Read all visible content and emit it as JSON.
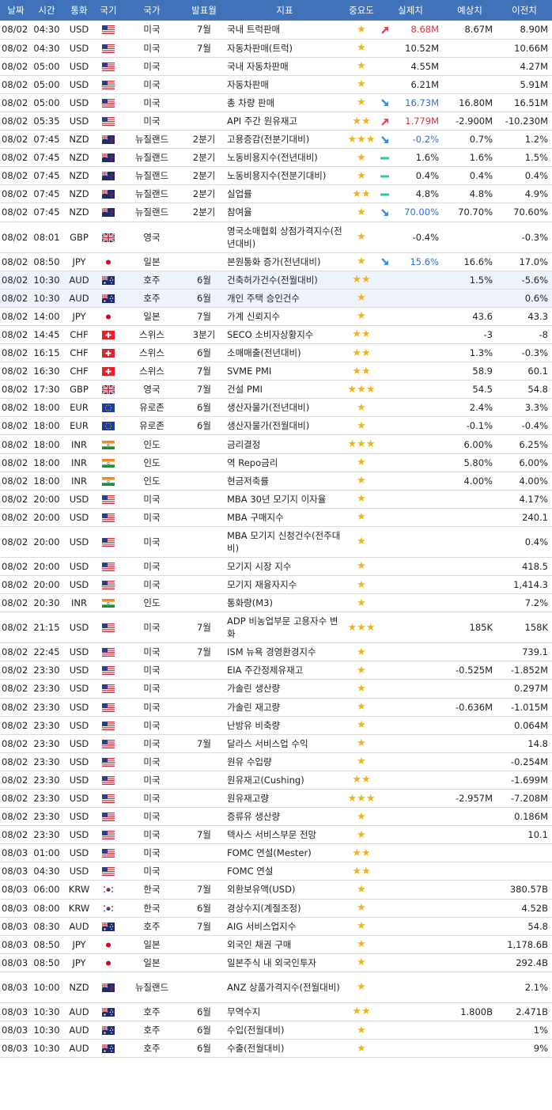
{
  "headers": [
    "날짜",
    "시간",
    "통화",
    "국기",
    "국가",
    "발표월",
    "지표",
    "중요도",
    "실제치",
    "예상치",
    "이전치"
  ],
  "colors": {
    "header_bg": "#3f72b8",
    "star": "#f2b31a",
    "up": "#e0303f",
    "down": "#2f6fd6",
    "neutral": "#2dc99a",
    "highlight": "#eef2fb"
  },
  "rows": [
    {
      "date": "08/02",
      "time": "04:30",
      "cur": "USD",
      "flag": "us",
      "country": "미국",
      "period": "7월",
      "indicator": "국내 트럭판매",
      "stars": "★",
      "dir": "up",
      "actual": "8.68M",
      "forecast": "8.67M",
      "previous": "8.90M"
    },
    {
      "date": "08/02",
      "time": "04:30",
      "cur": "USD",
      "flag": "us",
      "country": "미국",
      "period": "7월",
      "indicator": "자동차판매(트럭)",
      "stars": "★",
      "dir": "",
      "actual": "10.52M",
      "forecast": "",
      "previous": "10.66M"
    },
    {
      "date": "08/02",
      "time": "05:00",
      "cur": "USD",
      "flag": "us",
      "country": "미국",
      "period": "",
      "indicator": "국내 자동차판매",
      "stars": "★",
      "dir": "",
      "actual": "4.55M",
      "forecast": "",
      "previous": "4.27M"
    },
    {
      "date": "08/02",
      "time": "05:00",
      "cur": "USD",
      "flag": "us",
      "country": "미국",
      "period": "",
      "indicator": "자동차판매",
      "stars": "★",
      "dir": "",
      "actual": "6.21M",
      "forecast": "",
      "previous": "5.91M"
    },
    {
      "date": "08/02",
      "time": "05:00",
      "cur": "USD",
      "flag": "us",
      "country": "미국",
      "period": "",
      "indicator": "총 차량 판매",
      "stars": "★",
      "dir": "down",
      "actual": "16.73M",
      "forecast": "16.80M",
      "previous": "16.51M"
    },
    {
      "date": "08/02",
      "time": "05:35",
      "cur": "USD",
      "flag": "us",
      "country": "미국",
      "period": "",
      "indicator": "API 주간 원유재고",
      "stars": "★★",
      "dir": "up",
      "actual": "1.779M",
      "forecast": "-2.900M",
      "previous": "-10.230M"
    },
    {
      "date": "08/02",
      "time": "07:45",
      "cur": "NZD",
      "flag": "nz",
      "country": "뉴질랜드",
      "period": "2분기",
      "indicator": "고용증감(전분기대비)",
      "stars": "★★★",
      "dir": "down",
      "actual": "-0.2%",
      "forecast": "0.7%",
      "previous": "1.2%"
    },
    {
      "date": "08/02",
      "time": "07:45",
      "cur": "NZD",
      "flag": "nz",
      "country": "뉴질랜드",
      "period": "2분기",
      "indicator": "노동비용지수(전년대비)",
      "stars": "★",
      "dir": "same",
      "actual": "1.6%",
      "forecast": "1.6%",
      "previous": "1.5%"
    },
    {
      "date": "08/02",
      "time": "07:45",
      "cur": "NZD",
      "flag": "nz",
      "country": "뉴질랜드",
      "period": "2분기",
      "indicator": "노동비용지수(전분기대비)",
      "stars": "★",
      "dir": "same",
      "actual": "0.4%",
      "forecast": "0.4%",
      "previous": "0.4%"
    },
    {
      "date": "08/02",
      "time": "07:45",
      "cur": "NZD",
      "flag": "nz",
      "country": "뉴질랜드",
      "period": "2분기",
      "indicator": "실업률",
      "stars": "★★",
      "dir": "same",
      "actual": "4.8%",
      "forecast": "4.8%",
      "previous": "4.9%"
    },
    {
      "date": "08/02",
      "time": "07:45",
      "cur": "NZD",
      "flag": "nz",
      "country": "뉴질랜드",
      "period": "2분기",
      "indicator": "참여율",
      "stars": "★",
      "dir": "down",
      "actual": "70.00%",
      "forecast": "70.70%",
      "previous": "70.60%"
    },
    {
      "date": "08/02",
      "time": "08:01",
      "cur": "GBP",
      "flag": "gb",
      "country": "영국",
      "period": "",
      "indicator": "영국소매협회 상점가격지수(전년대비)",
      "stars": "★",
      "dir": "",
      "actual": "-0.4%",
      "forecast": "",
      "previous": "-0.3%",
      "tall": true
    },
    {
      "date": "08/02",
      "time": "08:50",
      "cur": "JPY",
      "flag": "jp",
      "country": "일본",
      "period": "",
      "indicator": "본원통화 증가(전년대비)",
      "stars": "★",
      "dir": "down",
      "actual": "15.6%",
      "forecast": "16.6%",
      "previous": "17.0%"
    },
    {
      "date": "08/02",
      "time": "10:30",
      "cur": "AUD",
      "flag": "au",
      "country": "호주",
      "period": "6월",
      "indicator": "건축허가건수(전월대비)",
      "stars": "★★",
      "dir": "",
      "actual": "",
      "forecast": "1.5%",
      "previous": "-5.6%",
      "hl": true
    },
    {
      "date": "08/02",
      "time": "10:30",
      "cur": "AUD",
      "flag": "au",
      "country": "호주",
      "period": "6월",
      "indicator": "개인 주택 승인건수",
      "stars": "★",
      "dir": "",
      "actual": "",
      "forecast": "",
      "previous": "0.6%",
      "hl": true
    },
    {
      "date": "08/02",
      "time": "14:00",
      "cur": "JPY",
      "flag": "jp",
      "country": "일본",
      "period": "7월",
      "indicator": "가계 신뢰지수",
      "stars": "★",
      "dir": "",
      "actual": "",
      "forecast": "43.6",
      "previous": "43.3"
    },
    {
      "date": "08/02",
      "time": "14:45",
      "cur": "CHF",
      "flag": "ch",
      "country": "스위스",
      "period": "3분기",
      "indicator": "SECO 소비자상황지수",
      "stars": "★★",
      "dir": "",
      "actual": "",
      "forecast": "-3",
      "previous": "-8"
    },
    {
      "date": "08/02",
      "time": "16:15",
      "cur": "CHF",
      "flag": "ch",
      "country": "스위스",
      "period": "6월",
      "indicator": "소매매출(전년대비)",
      "stars": "★★",
      "dir": "",
      "actual": "",
      "forecast": "1.3%",
      "previous": "-0.3%"
    },
    {
      "date": "08/02",
      "time": "16:30",
      "cur": "CHF",
      "flag": "ch",
      "country": "스위스",
      "period": "7월",
      "indicator": "SVME PMI",
      "stars": "★★",
      "dir": "",
      "actual": "",
      "forecast": "58.9",
      "previous": "60.1"
    },
    {
      "date": "08/02",
      "time": "17:30",
      "cur": "GBP",
      "flag": "gb",
      "country": "영국",
      "period": "7월",
      "indicator": "건설 PMI",
      "stars": "★★★",
      "dir": "",
      "actual": "",
      "forecast": "54.5",
      "previous": "54.8"
    },
    {
      "date": "08/02",
      "time": "18:00",
      "cur": "EUR",
      "flag": "eu",
      "country": "유로존",
      "period": "6월",
      "indicator": "생산자물가(전년대비)",
      "stars": "★",
      "dir": "",
      "actual": "",
      "forecast": "2.4%",
      "previous": "3.3%"
    },
    {
      "date": "08/02",
      "time": "18:00",
      "cur": "EUR",
      "flag": "eu",
      "country": "유로존",
      "period": "6월",
      "indicator": "생산자물가(전월대비)",
      "stars": "★",
      "dir": "",
      "actual": "",
      "forecast": "-0.1%",
      "previous": "-0.4%"
    },
    {
      "date": "08/02",
      "time": "18:00",
      "cur": "INR",
      "flag": "in",
      "country": "인도",
      "period": "",
      "indicator": "금리결정",
      "stars": "★★★",
      "dir": "",
      "actual": "",
      "forecast": "6.00%",
      "previous": "6.25%"
    },
    {
      "date": "08/02",
      "time": "18:00",
      "cur": "INR",
      "flag": "in",
      "country": "인도",
      "period": "",
      "indicator": "역 Repo금리",
      "stars": "★",
      "dir": "",
      "actual": "",
      "forecast": "5.80%",
      "previous": "6.00%"
    },
    {
      "date": "08/02",
      "time": "18:00",
      "cur": "INR",
      "flag": "in",
      "country": "인도",
      "period": "",
      "indicator": "현금저축률",
      "stars": "★",
      "dir": "",
      "actual": "",
      "forecast": "4.00%",
      "previous": "4.00%"
    },
    {
      "date": "08/02",
      "time": "20:00",
      "cur": "USD",
      "flag": "us",
      "country": "미국",
      "period": "",
      "indicator": "MBA 30년 모기지 이자율",
      "stars": "★",
      "dir": "",
      "actual": "",
      "forecast": "",
      "previous": "4.17%"
    },
    {
      "date": "08/02",
      "time": "20:00",
      "cur": "USD",
      "flag": "us",
      "country": "미국",
      "period": "",
      "indicator": "MBA 구매지수",
      "stars": "★",
      "dir": "",
      "actual": "",
      "forecast": "",
      "previous": "240.1"
    },
    {
      "date": "08/02",
      "time": "20:00",
      "cur": "USD",
      "flag": "us",
      "country": "미국",
      "period": "",
      "indicator": "MBA 모기지 신청건수(전주대비)",
      "stars": "★",
      "dir": "",
      "actual": "",
      "forecast": "",
      "previous": "0.4%",
      "tall": true
    },
    {
      "date": "08/02",
      "time": "20:00",
      "cur": "USD",
      "flag": "us",
      "country": "미국",
      "period": "",
      "indicator": "모기지 시장 지수",
      "stars": "★",
      "dir": "",
      "actual": "",
      "forecast": "",
      "previous": "418.5"
    },
    {
      "date": "08/02",
      "time": "20:00",
      "cur": "USD",
      "flag": "us",
      "country": "미국",
      "period": "",
      "indicator": "모기지 재융자지수",
      "stars": "★",
      "dir": "",
      "actual": "",
      "forecast": "",
      "previous": "1,414.3"
    },
    {
      "date": "08/02",
      "time": "20:30",
      "cur": "INR",
      "flag": "in",
      "country": "인도",
      "period": "",
      "indicator": "통화량(M3)",
      "stars": "★",
      "dir": "",
      "actual": "",
      "forecast": "",
      "previous": "7.2%"
    },
    {
      "date": "08/02",
      "time": "21:15",
      "cur": "USD",
      "flag": "us",
      "country": "미국",
      "period": "7월",
      "indicator": "ADP 비농업부문 고용자수 변화",
      "stars": "★★★",
      "dir": "",
      "actual": "",
      "forecast": "185K",
      "previous": "158K",
      "tall": true
    },
    {
      "date": "08/02",
      "time": "22:45",
      "cur": "USD",
      "flag": "us",
      "country": "미국",
      "period": "7월",
      "indicator": "ISM 뉴욕 경영환경지수",
      "stars": "★",
      "dir": "",
      "actual": "",
      "forecast": "",
      "previous": "739.1"
    },
    {
      "date": "08/02",
      "time": "23:30",
      "cur": "USD",
      "flag": "us",
      "country": "미국",
      "period": "",
      "indicator": "EIA 주간정제유재고",
      "stars": "★",
      "dir": "",
      "actual": "",
      "forecast": "-0.525M",
      "previous": "-1.852M"
    },
    {
      "date": "08/02",
      "time": "23:30",
      "cur": "USD",
      "flag": "us",
      "country": "미국",
      "period": "",
      "indicator": "가솔린 생산량",
      "stars": "★",
      "dir": "",
      "actual": "",
      "forecast": "",
      "previous": "0.297M"
    },
    {
      "date": "08/02",
      "time": "23:30",
      "cur": "USD",
      "flag": "us",
      "country": "미국",
      "period": "",
      "indicator": "가솔린 재고량",
      "stars": "★",
      "dir": "",
      "actual": "",
      "forecast": "-0.636M",
      "previous": "-1.015M"
    },
    {
      "date": "08/02",
      "time": "23:30",
      "cur": "USD",
      "flag": "us",
      "country": "미국",
      "period": "",
      "indicator": "난방유 비축량",
      "stars": "★",
      "dir": "",
      "actual": "",
      "forecast": "",
      "previous": "0.064M"
    },
    {
      "date": "08/02",
      "time": "23:30",
      "cur": "USD",
      "flag": "us",
      "country": "미국",
      "period": "7월",
      "indicator": "달라스 서비스업 수익",
      "stars": "★",
      "dir": "",
      "actual": "",
      "forecast": "",
      "previous": "14.8"
    },
    {
      "date": "08/02",
      "time": "23:30",
      "cur": "USD",
      "flag": "us",
      "country": "미국",
      "period": "",
      "indicator": "원유 수입량",
      "stars": "★",
      "dir": "",
      "actual": "",
      "forecast": "",
      "previous": "-0.254M"
    },
    {
      "date": "08/02",
      "time": "23:30",
      "cur": "USD",
      "flag": "us",
      "country": "미국",
      "period": "",
      "indicator": "원유재고(Cushing)",
      "stars": "★★",
      "dir": "",
      "actual": "",
      "forecast": "",
      "previous": "-1.699M"
    },
    {
      "date": "08/02",
      "time": "23:30",
      "cur": "USD",
      "flag": "us",
      "country": "미국",
      "period": "",
      "indicator": "원유재고량",
      "stars": "★★★",
      "dir": "",
      "actual": "",
      "forecast": "-2.957M",
      "previous": "-7.208M"
    },
    {
      "date": "08/02",
      "time": "23:30",
      "cur": "USD",
      "flag": "us",
      "country": "미국",
      "period": "",
      "indicator": "증류유 생산량",
      "stars": "★",
      "dir": "",
      "actual": "",
      "forecast": "",
      "previous": "0.186M"
    },
    {
      "date": "08/02",
      "time": "23:30",
      "cur": "USD",
      "flag": "us",
      "country": "미국",
      "period": "7월",
      "indicator": "텍사스 서비스부문 전망",
      "stars": "★",
      "dir": "",
      "actual": "",
      "forecast": "",
      "previous": "10.1"
    },
    {
      "date": "08/03",
      "time": "01:00",
      "cur": "USD",
      "flag": "us",
      "country": "미국",
      "period": "",
      "indicator": "FOMC 연설(Mester)",
      "stars": "★★",
      "dir": "",
      "actual": "",
      "forecast": "",
      "previous": ""
    },
    {
      "date": "08/03",
      "time": "04:30",
      "cur": "USD",
      "flag": "us",
      "country": "미국",
      "period": "",
      "indicator": "FOMC 연설",
      "stars": "★★",
      "dir": "",
      "actual": "",
      "forecast": "",
      "previous": ""
    },
    {
      "date": "08/03",
      "time": "06:00",
      "cur": "KRW",
      "flag": "kr",
      "country": "한국",
      "period": "7월",
      "indicator": "외환보유액(USD)",
      "stars": "★",
      "dir": "",
      "actual": "",
      "forecast": "",
      "previous": "380.57B"
    },
    {
      "date": "08/03",
      "time": "08:00",
      "cur": "KRW",
      "flag": "kr",
      "country": "한국",
      "period": "6월",
      "indicator": "경상수지(계절조정)",
      "stars": "★",
      "dir": "",
      "actual": "",
      "forecast": "",
      "previous": "4.52B"
    },
    {
      "date": "08/03",
      "time": "08:30",
      "cur": "AUD",
      "flag": "au",
      "country": "호주",
      "period": "7월",
      "indicator": "AIG 서비스업지수",
      "stars": "★",
      "dir": "",
      "actual": "",
      "forecast": "",
      "previous": "54.8"
    },
    {
      "date": "08/03",
      "time": "08:50",
      "cur": "JPY",
      "flag": "jp",
      "country": "일본",
      "period": "",
      "indicator": "외국인 채권 구매",
      "stars": "★",
      "dir": "",
      "actual": "",
      "forecast": "",
      "previous": "1,178.6B"
    },
    {
      "date": "08/03",
      "time": "08:50",
      "cur": "JPY",
      "flag": "jp",
      "country": "일본",
      "period": "",
      "indicator": "일본주식 내 외국인투자",
      "stars": "★",
      "dir": "",
      "actual": "",
      "forecast": "",
      "previous": "292.4B"
    },
    {
      "date": "08/03",
      "time": "10:00",
      "cur": "NZD",
      "flag": "nz",
      "country": "뉴질랜드",
      "period": "",
      "indicator": "ANZ 상품가격지수(전월대비)",
      "stars": "★",
      "dir": "",
      "actual": "",
      "forecast": "",
      "previous": "2.1%",
      "tall": true
    },
    {
      "date": "08/03",
      "time": "10:30",
      "cur": "AUD",
      "flag": "au",
      "country": "호주",
      "period": "6월",
      "indicator": "무역수지",
      "stars": "★★",
      "dir": "",
      "actual": "",
      "forecast": "1.800B",
      "previous": "2.471B"
    },
    {
      "date": "08/03",
      "time": "10:30",
      "cur": "AUD",
      "flag": "au",
      "country": "호주",
      "period": "6월",
      "indicator": "수입(전월대비)",
      "stars": "★",
      "dir": "",
      "actual": "",
      "forecast": "",
      "previous": "1%"
    },
    {
      "date": "08/03",
      "time": "10:30",
      "cur": "AUD",
      "flag": "au",
      "country": "호주",
      "period": "6월",
      "indicator": "수출(전월대비)",
      "stars": "★",
      "dir": "",
      "actual": "",
      "forecast": "",
      "previous": "9%"
    }
  ]
}
